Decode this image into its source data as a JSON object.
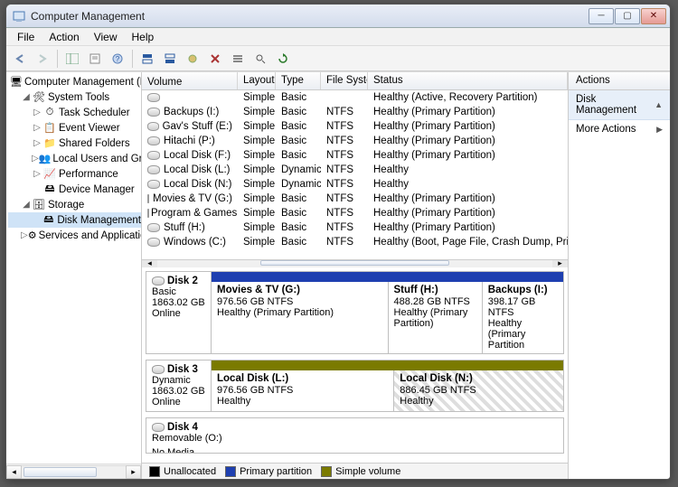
{
  "window": {
    "title": "Computer Management"
  },
  "menu": [
    "File",
    "Action",
    "View",
    "Help"
  ],
  "toolbar_icons": [
    "⟵",
    "⟶",
    "⬆",
    "◫",
    "📄",
    "❓",
    "📊",
    "🖴",
    "✖",
    "📋",
    "🔍",
    "🛈",
    "🔄"
  ],
  "tree": {
    "root": "Computer Management (Local",
    "system_tools": "System Tools",
    "task_scheduler": "Task Scheduler",
    "event_viewer": "Event Viewer",
    "shared_folders": "Shared Folders",
    "local_users": "Local Users and Groups",
    "performance": "Performance",
    "device_mgr": "Device Manager",
    "storage": "Storage",
    "disk_mgmt": "Disk Management",
    "services": "Services and Applications"
  },
  "vol_headers": {
    "volume": "Volume",
    "layout": "Layout",
    "type": "Type",
    "fs": "File System",
    "status": "Status"
  },
  "volumes": [
    {
      "name": "",
      "layout": "Simple",
      "type": "Basic",
      "fs": "",
      "status": "Healthy (Active, Recovery Partition)"
    },
    {
      "name": "Backups (I:)",
      "layout": "Simple",
      "type": "Basic",
      "fs": "NTFS",
      "status": "Healthy (Primary Partition)"
    },
    {
      "name": "Gav's Stuff (E:)",
      "layout": "Simple",
      "type": "Basic",
      "fs": "NTFS",
      "status": "Healthy (Primary Partition)"
    },
    {
      "name": "Hitachi (P:)",
      "layout": "Simple",
      "type": "Basic",
      "fs": "NTFS",
      "status": "Healthy (Primary Partition)"
    },
    {
      "name": "Local Disk (F:)",
      "layout": "Simple",
      "type": "Basic",
      "fs": "NTFS",
      "status": "Healthy (Primary Partition)"
    },
    {
      "name": "Local Disk (L:)",
      "layout": "Simple",
      "type": "Dynamic",
      "fs": "NTFS",
      "status": "Healthy"
    },
    {
      "name": "Local Disk (N:)",
      "layout": "Simple",
      "type": "Dynamic",
      "fs": "NTFS",
      "status": "Healthy"
    },
    {
      "name": "Movies & TV (G:)",
      "layout": "Simple",
      "type": "Basic",
      "fs": "NTFS",
      "status": "Healthy (Primary Partition)"
    },
    {
      "name": "Program & Games (D:)",
      "layout": "Simple",
      "type": "Basic",
      "fs": "NTFS",
      "status": "Healthy (Primary Partition)"
    },
    {
      "name": "Stuff (H:)",
      "layout": "Simple",
      "type": "Basic",
      "fs": "NTFS",
      "status": "Healthy (Primary Partition)"
    },
    {
      "name": "Windows (C:)",
      "layout": "Simple",
      "type": "Basic",
      "fs": "NTFS",
      "status": "Healthy (Boot, Page File, Crash Dump, Primary Par"
    }
  ],
  "disk2": {
    "title": "Disk 2",
    "type": "Basic",
    "size": "1863.02 GB",
    "state": "Online",
    "parts": [
      {
        "name": "Movies & TV  (G:)",
        "size": "976.56 GB NTFS",
        "status": "Healthy (Primary Partition)"
      },
      {
        "name": "Stuff  (H:)",
        "size": "488.28 GB NTFS",
        "status": "Healthy (Primary Partition)"
      },
      {
        "name": "Backups  (I:)",
        "size": "398.17 GB NTFS",
        "status": "Healthy (Primary Partition"
      }
    ]
  },
  "disk3": {
    "title": "Disk 3",
    "type": "Dynamic",
    "size": "1863.02 GB",
    "state": "Online",
    "parts": [
      {
        "name": "Local Disk  (L:)",
        "size": "976.56 GB NTFS",
        "status": "Healthy"
      },
      {
        "name": "Local Disk  (N:)",
        "size": "886.45 GB NTFS",
        "status": "Healthy"
      }
    ]
  },
  "disk4": {
    "title": "Disk 4",
    "type": "Removable (O:)",
    "state": "No Media"
  },
  "legend": {
    "un": "Unallocated",
    "pp": "Primary partition",
    "sv": "Simple volume"
  },
  "actions": {
    "header": "Actions",
    "dm": "Disk Management",
    "more": "More Actions"
  }
}
